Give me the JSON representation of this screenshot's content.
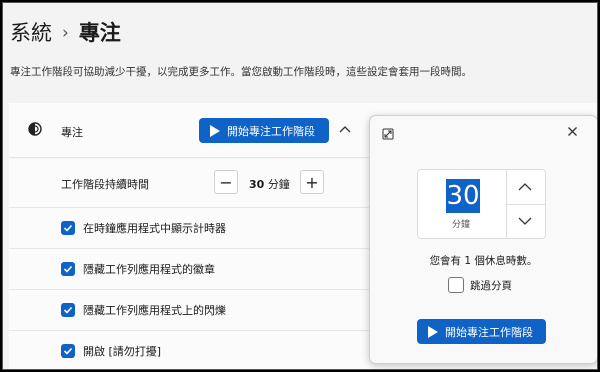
{
  "breadcrumb": {
    "parent": "系統",
    "separator": "›",
    "current": "專注"
  },
  "description": "專注工作階段可協助減少干擾，以完成更多工作。當您啟動工作階段時，這些設定會套用一段時間。",
  "focus_row": {
    "label": "專注",
    "start_button": "開始專注工作階段"
  },
  "duration_row": {
    "label": "工作階段持續時間",
    "value": "30",
    "unit": "分鐘",
    "minus": "−",
    "plus": "+"
  },
  "options": [
    {
      "label": "在時鐘應用程式中顯示計時器",
      "checked": true
    },
    {
      "label": "隱藏工作列應用程式的徽章",
      "checked": true
    },
    {
      "label": "隱藏工作列應用程式上的閃爍",
      "checked": true
    },
    {
      "label": "開啟 [請勿打擾]",
      "checked": true
    }
  ],
  "popup": {
    "minutes": "30",
    "unit": "分鐘",
    "breaks_text": "您會有 1 個休息時數。",
    "skip_breaks": "跳過分頁",
    "start_button": "開始專注工作階段"
  },
  "colors": {
    "accent": "#0f62c6",
    "background": "#f3f3f3",
    "card": "#fbfbfb"
  }
}
